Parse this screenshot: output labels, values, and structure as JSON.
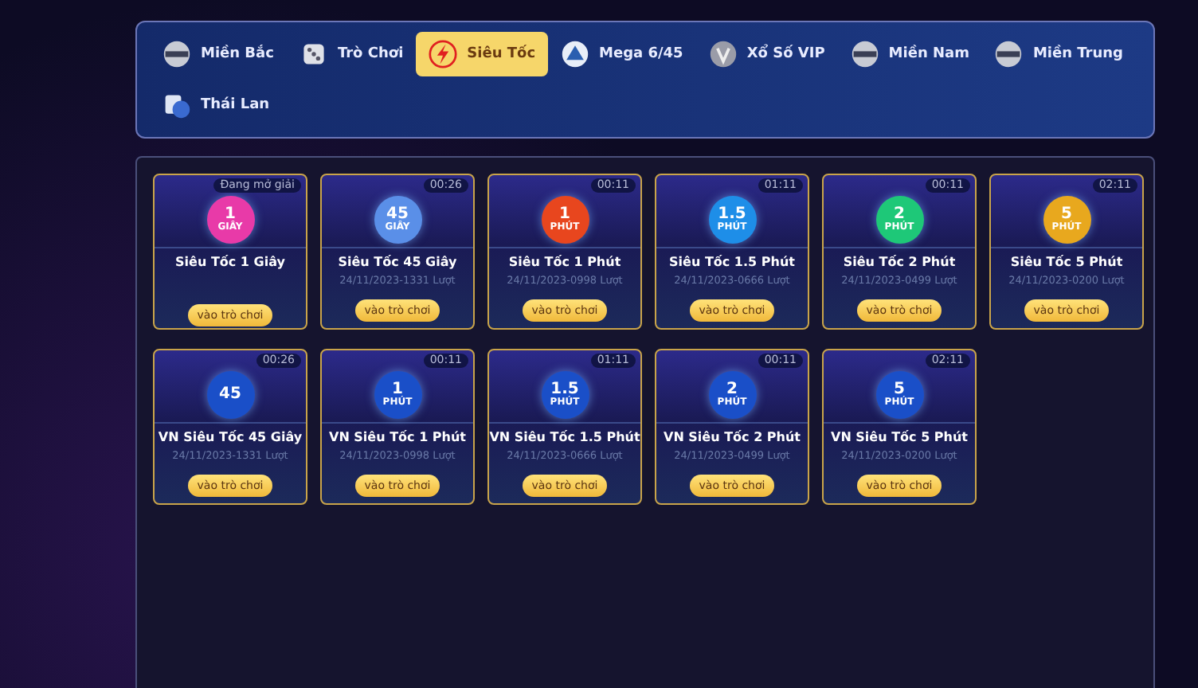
{
  "tabs": [
    {
      "label": "Miền Bắc",
      "kind": "medal",
      "selected": false
    },
    {
      "label": "Trò Chơi",
      "kind": "dice",
      "selected": false
    },
    {
      "label": "Siêu Tốc",
      "kind": "bolt",
      "selected": true
    },
    {
      "label": "Mega 6/45",
      "kind": "mega",
      "selected": false
    },
    {
      "label": "Xổ Số VIP",
      "kind": "coin",
      "selected": false
    },
    {
      "label": "Miền Nam",
      "kind": "medal",
      "selected": false
    },
    {
      "label": "Miền Trung",
      "kind": "medal",
      "selected": false
    },
    {
      "label": "Thái Lan",
      "kind": "cards",
      "selected": false
    }
  ],
  "games": [
    {
      "title": "Siêu Tốc 1 Giây",
      "badge": "Đang mở giải",
      "logo": [
        "1",
        "GIÂY"
      ],
      "color": "#e83aa8",
      "button": "vào trò chơi"
    },
    {
      "title": "Siêu Tốc 45 Giây",
      "badge": "00:26",
      "info": "24/11/2023-1331 Lượt",
      "logo": [
        "45",
        "GIÂY"
      ],
      "color": "#5a8fe8",
      "button": "vào trò chơi"
    },
    {
      "title": "Siêu Tốc 1 Phút",
      "badge": "00:11",
      "info": "24/11/2023-0998 Lượt",
      "logo": [
        "1",
        "PHÚT"
      ],
      "color": "#e8461e",
      "button": "vào trò chơi"
    },
    {
      "title": "Siêu Tốc 1.5 Phút",
      "badge": "01:11",
      "info": "24/11/2023-0666 Lượt",
      "logo": [
        "1.5",
        "PHÚT"
      ],
      "color": "#1e8ee8",
      "button": "vào trò chơi"
    },
    {
      "title": "Siêu Tốc 2 Phút",
      "badge": "00:11",
      "info": "24/11/2023-0499 Lượt",
      "logo": [
        "2",
        "PHÚT"
      ],
      "color": "#1ec878",
      "button": "vào trò chơi"
    },
    {
      "title": "Siêu Tốc 5 Phút",
      "badge": "02:11",
      "info": "24/11/2023-0200 Lượt",
      "logo": [
        "5",
        "PHÚT"
      ],
      "color": "#e8a81e",
      "button": "vào trò chơi"
    },
    {
      "title": "VN Siêu Tốc 45 Giây",
      "badge": "00:26",
      "info": "24/11/2023-1331 Lượt",
      "logo": [
        "45"
      ],
      "color": "#1a4fc8",
      "button": "vào trò chơi"
    },
    {
      "title": "VN Siêu Tốc 1 Phút",
      "badge": "00:11",
      "info": "24/11/2023-0998 Lượt",
      "logo": [
        "1",
        "PHÚT"
      ],
      "color": "#1a4fc8",
      "button": "vào trò chơi"
    },
    {
      "title": "VN Siêu Tốc 1.5 Phút",
      "badge": "01:11",
      "info": "24/11/2023-0666 Lượt",
      "logo": [
        "1.5",
        "PHÚT"
      ],
      "color": "#1a4fc8",
      "button": "vào trò chơi"
    },
    {
      "title": "VN Siêu Tốc 2 Phút",
      "badge": "00:11",
      "info": "24/11/2023-0499 Lượt",
      "logo": [
        "2",
        "PHÚT"
      ],
      "color": "#1a4fc8",
      "button": "vào trò chơi"
    },
    {
      "title": "VN Siêu Tốc 5 Phút",
      "badge": "02:11",
      "info": "24/11/2023-0200 Lượt",
      "logo": [
        "5",
        "PHÚT"
      ],
      "color": "#1a4fc8",
      "button": "vào trò chơi"
    }
  ]
}
